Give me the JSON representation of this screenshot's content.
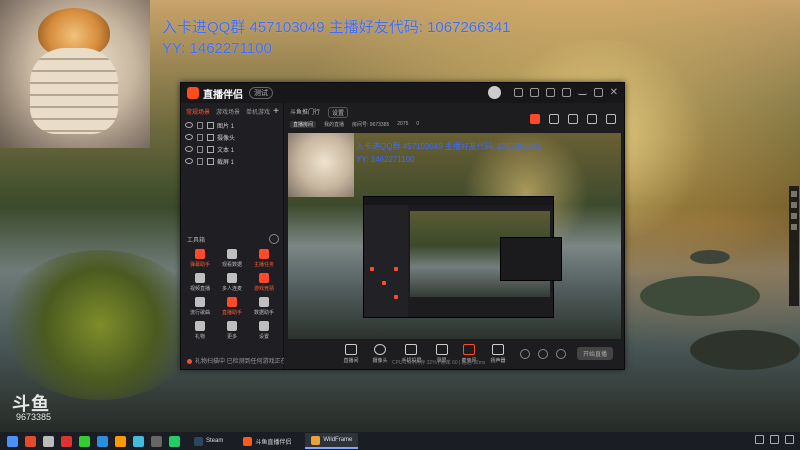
{
  "overlay": {
    "line1": "入卡进QQ群 457103049  主播好友代码: 1067266341",
    "line2": "YY:  1462271100"
  },
  "app": {
    "name": "直播伴侣",
    "version": "测试",
    "left_tabs": [
      "常规场景",
      "游戏场景",
      "单机游戏"
    ],
    "add_label": "+",
    "sources": [
      {
        "label": "图片 1"
      },
      {
        "label": "摄像头"
      },
      {
        "label": "文本 1"
      },
      {
        "label": "截屏 1"
      }
    ],
    "toolbox_title": "工具箱",
    "tools": [
      {
        "label": "弹幕助手",
        "red": true
      },
      {
        "label": "观看数据",
        "red": false
      },
      {
        "label": "主播任务",
        "red": true
      },
      {
        "label": "视频直播",
        "red": false
      },
      {
        "label": "多人连麦",
        "red": false
      },
      {
        "label": "游戏竞猜",
        "red": true
      },
      {
        "label": "流行歌曲",
        "red": false
      },
      {
        "label": "直播助手",
        "red": true
      },
      {
        "label": "数据助手",
        "red": false
      },
      {
        "label": "礼物",
        "red": false
      },
      {
        "label": "更多",
        "red": false
      },
      {
        "label": "设置",
        "red": false
      }
    ],
    "status_text": "礼物扫描中  已检测到任何游戏正在运行中, 请先启动游戏",
    "main_tabs": [
      "斗鱼推门行",
      "设置"
    ],
    "info": {
      "room_tag": "直播房间",
      "category": "我的直播",
      "room_id": "房间号: 9673385",
      "fans": "2075",
      "gifts": "0"
    },
    "preview_overlay_line1": "入卡进QQ群 457103049  主播好友代码: 1067266341",
    "preview_overlay_line2": "YY: 1462271100",
    "bottom_tools": [
      "直播间",
      "摄像头",
      "手机投屏",
      "录屏",
      "麦克风",
      "扬声器"
    ],
    "live_button": "开始直播",
    "net_status": "CPU 1% | 内存 32% | 帧率 60 | 延迟 12ms"
  },
  "watermark": {
    "brand": "斗鱼",
    "room": "9673385"
  },
  "taskbar": {
    "tasks": [
      {
        "label": "Steam",
        "active": false
      },
      {
        "label": "斗鱼直播伴侣",
        "active": false
      },
      {
        "label": "WildFrame",
        "active": true
      }
    ]
  }
}
